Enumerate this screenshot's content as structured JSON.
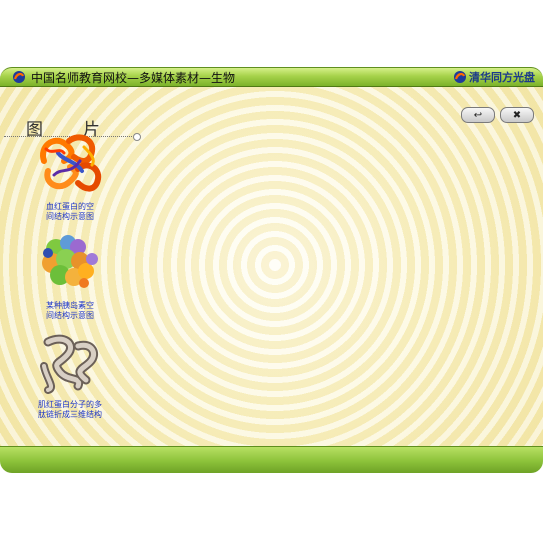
{
  "window": {
    "title": "中国名师教育网校—多媒体素材—生物",
    "brand": "清华同方光盘"
  },
  "toolbar": {
    "back_label": "↩",
    "close_label": "✖"
  },
  "section": {
    "title": "图　　片"
  },
  "items": [
    {
      "caption_line1": "血红蛋白的空",
      "caption_line2": "间结构示意图",
      "icon": "hemoglobin-structure-image"
    },
    {
      "caption_line1": "某种胰岛素空",
      "caption_line2": "间结构示意图",
      "icon": "insulin-structure-image"
    },
    {
      "caption_line1": "肌红蛋白分子的多",
      "caption_line2": "肽链折成三维结构",
      "icon": "myoglobin-structure-image"
    }
  ],
  "colors": {
    "titlebar": "#a6d24a",
    "caption": "#1d35c9",
    "background": "#faf3c8"
  }
}
